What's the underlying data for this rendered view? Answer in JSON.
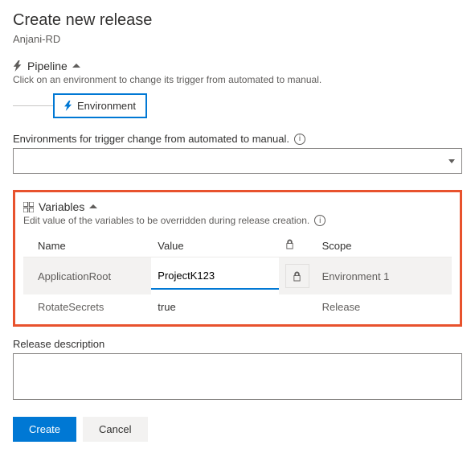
{
  "title": "Create new release",
  "subtitle": "Anjani-RD",
  "pipeline": {
    "header": "Pipeline",
    "caption": "Click on an environment to change its trigger from automated to manual.",
    "stage_label": "Environment"
  },
  "env_selector": {
    "label": "Environments for trigger change from automated to manual."
  },
  "variables": {
    "header": "Variables",
    "caption": "Edit value of the variables to be overridden during release creation.",
    "columns": {
      "name": "Name",
      "value": "Value",
      "scope": "Scope"
    },
    "rows": [
      {
        "name": "ApplicationRoot",
        "value": "ProjectK123",
        "scope": "Environment 1",
        "active": true
      },
      {
        "name": "RotateSecrets",
        "value": "true",
        "scope": "Release",
        "active": false
      }
    ]
  },
  "description": {
    "label": "Release description",
    "value": ""
  },
  "buttons": {
    "create": "Create",
    "cancel": "Cancel"
  }
}
